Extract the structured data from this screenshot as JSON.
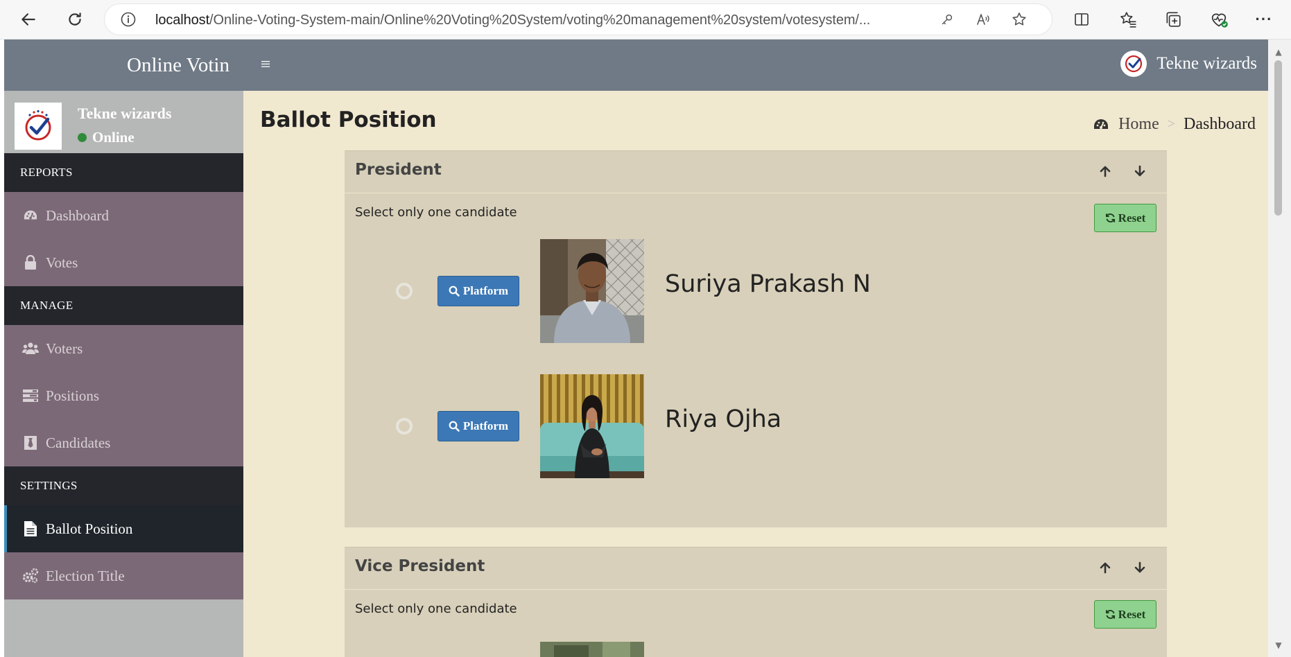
{
  "browser": {
    "url_host": "localhost",
    "url_path": "/Online-Voting-System-main/Online%20Voting%20System/voting%20management%20system/votesystem/..."
  },
  "app": {
    "logo_text": "Online Votin",
    "top_user_name": "Tekne wizards"
  },
  "sidebar": {
    "user_name": "Tekne wizards",
    "user_status": "Online",
    "sections": [
      {
        "header": "REPORTS",
        "items": [
          {
            "label": "Dashboard",
            "icon": "dashboard-icon"
          },
          {
            "label": "Votes",
            "icon": "lock-icon"
          }
        ]
      },
      {
        "header": "MANAGE",
        "items": [
          {
            "label": "Voters",
            "icon": "users-icon"
          },
          {
            "label": "Positions",
            "icon": "tasks-icon"
          },
          {
            "label": "Candidates",
            "icon": "black-tie-icon"
          }
        ]
      },
      {
        "header": "SETTINGS",
        "items": [
          {
            "label": "Ballot Position",
            "icon": "file-text-icon",
            "active": true
          },
          {
            "label": "Election Title",
            "icon": "cogs-icon"
          }
        ]
      }
    ]
  },
  "page": {
    "title": "Ballot Position",
    "breadcrumb": {
      "home": "Home",
      "current": "Dashboard"
    }
  },
  "positions": [
    {
      "title": "President",
      "instruction": "Select only one candidate",
      "reset_label": "Reset",
      "candidates": [
        {
          "name": "Suriya Prakash N",
          "platform_label": "Platform"
        },
        {
          "name": "Riya Ojha",
          "platform_label": "Platform"
        }
      ]
    },
    {
      "title": "Vice President",
      "instruction": "Select only one candidate",
      "reset_label": "Reset"
    }
  ],
  "colors": {
    "topbar": "#6f7a86",
    "sidebar_header": "#24262b",
    "sidebar_item": "#7c6977",
    "content_bg": "#f1e8d0",
    "box_bg": "#d8d0ba",
    "primary_button": "#3c78b5",
    "success_button": "#8fd28f"
  }
}
